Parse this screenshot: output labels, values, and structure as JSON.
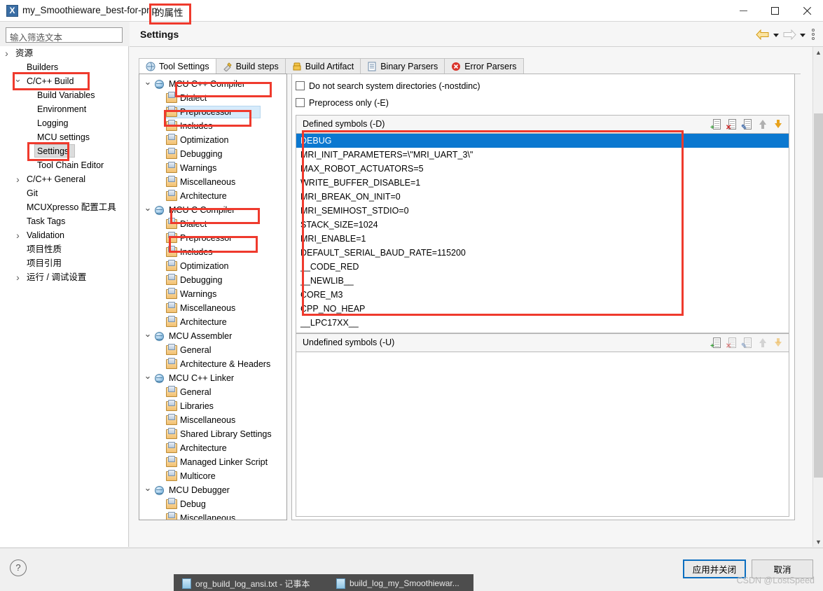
{
  "window": {
    "icon": "app-icon-x",
    "title": "my_Smoothieware_best-for-pnp",
    "title_suffix": "的属性",
    "minimize": "minimize-icon",
    "maximize": "maximize-icon",
    "close": "close-icon"
  },
  "filter": {
    "placeholder": "输入筛选文本",
    "value": ""
  },
  "sidebar": {
    "items": [
      {
        "label": "资源",
        "indent": 22,
        "twisty": "closed",
        "selected": false
      },
      {
        "label": "Builders",
        "indent": 38,
        "twisty": "none",
        "selected": false
      },
      {
        "label": "C/C++ Build",
        "indent": 38,
        "twisty": "open",
        "selected": false
      },
      {
        "label": "Build Variables",
        "indent": 53,
        "twisty": "none",
        "selected": false
      },
      {
        "label": "Environment",
        "indent": 53,
        "twisty": "none",
        "selected": false
      },
      {
        "label": "Logging",
        "indent": 53,
        "twisty": "none",
        "selected": false
      },
      {
        "label": "MCU settings",
        "indent": 53,
        "twisty": "none",
        "selected": false
      },
      {
        "label": "Settings",
        "indent": 53,
        "twisty": "none",
        "selected": true
      },
      {
        "label": "Tool Chain Editor",
        "indent": 53,
        "twisty": "none",
        "selected": false
      },
      {
        "label": "C/C++ General",
        "indent": 38,
        "twisty": "closed",
        "selected": false
      },
      {
        "label": "Git",
        "indent": 38,
        "twisty": "none",
        "selected": false
      },
      {
        "label": "MCUXpresso 配置工具",
        "indent": 38,
        "twisty": "none",
        "selected": false
      },
      {
        "label": "Task Tags",
        "indent": 38,
        "twisty": "none",
        "selected": false
      },
      {
        "label": "Validation",
        "indent": 38,
        "twisty": "closed",
        "selected": false
      },
      {
        "label": "项目性质",
        "indent": 38,
        "twisty": "none",
        "selected": false
      },
      {
        "label": "项目引用",
        "indent": 38,
        "twisty": "none",
        "selected": false
      },
      {
        "label": "运行 / 调试设置",
        "indent": 38,
        "twisty": "closed",
        "selected": false
      }
    ]
  },
  "header": {
    "title": "Settings",
    "back_icon": "back-arrow-icon",
    "back_menu_icon": "chevron-down-icon",
    "forward_icon": "forward-arrow-icon",
    "forward_menu_icon": "chevron-down-icon",
    "menu_icon": "view-menu-icon"
  },
  "tabs": [
    {
      "label": "Tool Settings",
      "icon": "tool-settings-icon",
      "active": true
    },
    {
      "label": "Build steps",
      "icon": "build-steps-icon",
      "active": false
    },
    {
      "label": "Build Artifact",
      "icon": "build-artifact-icon",
      "active": false
    },
    {
      "label": "Binary Parsers",
      "icon": "binary-parsers-icon",
      "active": false
    },
    {
      "label": "Error Parsers",
      "icon": "error-parsers-icon",
      "active": false
    }
  ],
  "tool_tree": [
    {
      "label": "MCU C++ Compiler",
      "level": 0,
      "icon": "mcu-icon",
      "selected": false
    },
    {
      "label": "Dialect",
      "level": 1,
      "icon": "page-icon",
      "selected": false
    },
    {
      "label": "Preprocessor",
      "level": 1,
      "icon": "page-icon",
      "selected": true
    },
    {
      "label": "Includes",
      "level": 1,
      "icon": "page-icon",
      "selected": false
    },
    {
      "label": "Optimization",
      "level": 1,
      "icon": "page-icon",
      "selected": false
    },
    {
      "label": "Debugging",
      "level": 1,
      "icon": "page-icon",
      "selected": false
    },
    {
      "label": "Warnings",
      "level": 1,
      "icon": "page-icon",
      "selected": false
    },
    {
      "label": "Miscellaneous",
      "level": 1,
      "icon": "page-icon",
      "selected": false
    },
    {
      "label": "Architecture",
      "level": 1,
      "icon": "page-icon",
      "selected": false
    },
    {
      "label": "MCU C Compiler",
      "level": 0,
      "icon": "mcu-icon",
      "selected": false
    },
    {
      "label": "Dialect",
      "level": 1,
      "icon": "page-icon",
      "selected": false
    },
    {
      "label": "Preprocessor",
      "level": 1,
      "icon": "page-icon",
      "selected": false
    },
    {
      "label": "Includes",
      "level": 1,
      "icon": "page-icon",
      "selected": false
    },
    {
      "label": "Optimization",
      "level": 1,
      "icon": "page-icon",
      "selected": false
    },
    {
      "label": "Debugging",
      "level": 1,
      "icon": "page-icon",
      "selected": false
    },
    {
      "label": "Warnings",
      "level": 1,
      "icon": "page-icon",
      "selected": false
    },
    {
      "label": "Miscellaneous",
      "level": 1,
      "icon": "page-icon",
      "selected": false
    },
    {
      "label": "Architecture",
      "level": 1,
      "icon": "page-icon",
      "selected": false
    },
    {
      "label": "MCU Assembler",
      "level": 0,
      "icon": "mcu-icon",
      "selected": false
    },
    {
      "label": "General",
      "level": 1,
      "icon": "page-icon",
      "selected": false
    },
    {
      "label": "Architecture & Headers",
      "level": 1,
      "icon": "page-icon",
      "selected": false
    },
    {
      "label": "MCU C++ Linker",
      "level": 0,
      "icon": "mcu-icon",
      "selected": false
    },
    {
      "label": "General",
      "level": 1,
      "icon": "page-icon",
      "selected": false
    },
    {
      "label": "Libraries",
      "level": 1,
      "icon": "page-icon",
      "selected": false
    },
    {
      "label": "Miscellaneous",
      "level": 1,
      "icon": "page-icon",
      "selected": false
    },
    {
      "label": "Shared Library Settings",
      "level": 1,
      "icon": "page-icon",
      "selected": false
    },
    {
      "label": "Architecture",
      "level": 1,
      "icon": "page-icon",
      "selected": false
    },
    {
      "label": "Managed Linker Script",
      "level": 1,
      "icon": "page-icon",
      "selected": false
    },
    {
      "label": "Multicore",
      "level": 1,
      "icon": "page-icon",
      "selected": false
    },
    {
      "label": "MCU Debugger",
      "level": 0,
      "icon": "mcu-icon",
      "selected": false
    },
    {
      "label": "Debug",
      "level": 1,
      "icon": "page-icon",
      "selected": false
    },
    {
      "label": "Miscellaneous",
      "level": 1,
      "icon": "page-icon",
      "selected": false
    }
  ],
  "detail": {
    "checkboxes": [
      {
        "label": "Do not search system directories (-nostdinc)",
        "checked": false
      },
      {
        "label": "Preprocess only (-E)",
        "checked": false
      }
    ],
    "defined_group": {
      "title": "Defined symbols (-D)",
      "tools": [
        "add-icon",
        "delete-icon",
        "edit-icon",
        "move-up-icon",
        "move-down-icon"
      ],
      "symbols": [
        "DEBUG",
        "MRI_INIT_PARAMETERS=\\\"MRI_UART_3\\\"",
        "MAX_ROBOT_ACTUATORS=5",
        "WRITE_BUFFER_DISABLE=1",
        "MRI_BREAK_ON_INIT=0",
        "MRI_SEMIHOST_STDIO=0",
        "STACK_SIZE=1024",
        "MRI_ENABLE=1",
        "DEFAULT_SERIAL_BAUD_RATE=115200",
        "__CODE_RED",
        "__NEWLIB__",
        "CORE_M3",
        "CPP_NO_HEAP",
        "__LPC17XX__"
      ],
      "selected_index": 0
    },
    "undefined_group": {
      "title": "Undefined symbols (-U)",
      "tools": [
        "add-icon",
        "delete-icon",
        "edit-icon",
        "move-up-icon",
        "move-down-icon"
      ],
      "symbols": []
    }
  },
  "footer": {
    "help_icon": "help-icon",
    "apply_and_close": "应用并关闭",
    "cancel": "取消"
  },
  "taskbar": {
    "items": [
      {
        "label": "org_build_log_ansi.txt - 记事本",
        "icon": "notepad-icon"
      },
      {
        "label": "build_log_my_Smoothiewar...",
        "icon": "notepad-icon"
      }
    ]
  },
  "watermark": "CSDN @LostSpeed",
  "colors": {
    "selection_blue": "#0b78d0",
    "annotation_red": "#ef3a2d",
    "accent_button": "#0b6ec0"
  }
}
